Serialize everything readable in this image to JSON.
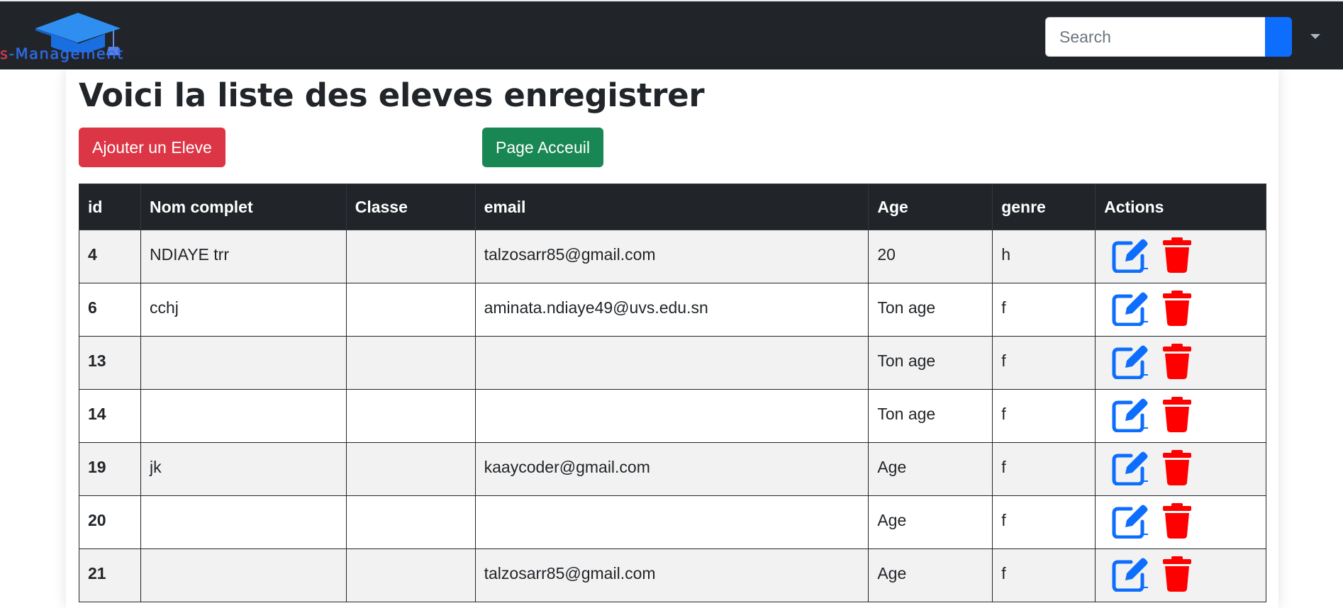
{
  "navbar": {
    "brand_first": "s",
    "brand_rest": "-Management",
    "logo_icon": "graduation-cap-icon",
    "search": {
      "placeholder": "Search",
      "value": ""
    },
    "dropdown_icon": "caret-down-icon"
  },
  "page": {
    "title": "Voici la liste des eleves enregistrer",
    "buttons": {
      "add_label": "Ajouter un Eleve",
      "home_label": "Page Acceuil"
    }
  },
  "table": {
    "headers": [
      "id",
      "Nom complet",
      "Classe",
      "email",
      "Age",
      "genre",
      "Actions"
    ],
    "rows": [
      {
        "id": "4",
        "nom": "NDIAYE trr",
        "classe": "",
        "email": "talzosarr85@gmail.com",
        "age": "20",
        "genre": "h"
      },
      {
        "id": "6",
        "nom": "cchj",
        "classe": "",
        "email": "aminata.ndiaye49@uvs.edu.sn",
        "age": "Ton age",
        "genre": "f"
      },
      {
        "id": "13",
        "nom": "",
        "classe": "",
        "email": "",
        "age": "Ton age",
        "genre": "f"
      },
      {
        "id": "14",
        "nom": "",
        "classe": "",
        "email": "",
        "age": "Ton age",
        "genre": "f"
      },
      {
        "id": "19",
        "nom": "jk",
        "classe": "",
        "email": "kaaycoder@gmail.com",
        "age": "Age",
        "genre": "f"
      },
      {
        "id": "20",
        "nom": "",
        "classe": "",
        "email": "",
        "age": "Age",
        "genre": "f"
      },
      {
        "id": "21",
        "nom": "",
        "classe": "",
        "email": "talzosarr85@gmail.com",
        "age": "Age",
        "genre": "f"
      }
    ],
    "action_icons": [
      "edit-icon",
      "trash-icon"
    ]
  },
  "colors": {
    "navbar_bg": "#212529",
    "primary": "#0d6efd",
    "danger": "#dc3545",
    "success": "#198754",
    "edit_icon": "#0d6efd",
    "trash_icon": "#ff0000",
    "row_striped": "#f2f2f2"
  }
}
